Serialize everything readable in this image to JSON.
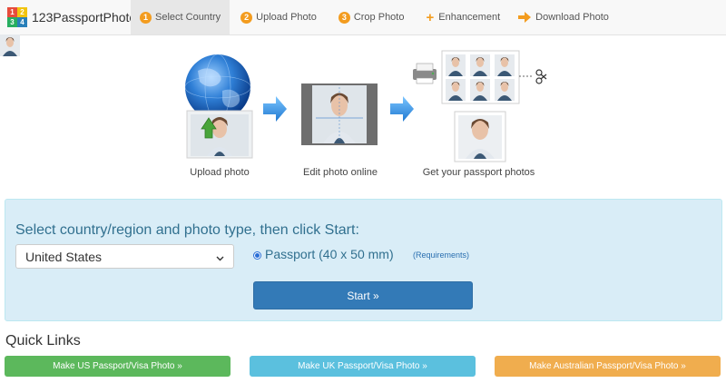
{
  "brand": {
    "name": "123PassportPhoto",
    "logo_digits": [
      "1",
      "2",
      "3",
      "4"
    ]
  },
  "nav": [
    {
      "label": "Select Country",
      "step": "1",
      "active": true
    },
    {
      "label": "Upload Photo",
      "step": "2"
    },
    {
      "label": "Crop Photo",
      "step": "3"
    },
    {
      "label": "Enhancement",
      "icon": "plus-icon"
    },
    {
      "label": "Download Photo",
      "icon": "arrow-right-icon"
    }
  ],
  "steps": {
    "upload_caption": "Upload photo",
    "edit_caption": "Edit photo online",
    "get_caption": "Get your passport photos"
  },
  "form": {
    "title": "Select country/region and photo type, then click Start:",
    "country_value": "United States",
    "photo_type": "Passport (40 x 50 mm)",
    "requirements_link": "(Requirements)",
    "start_label": "Start »"
  },
  "quick_links": {
    "title": "Quick Links",
    "items": [
      {
        "label": "Make US Passport/Visa Photo »",
        "color": "#5cb85c"
      },
      {
        "label": "Make UK Passport/Visa Photo »",
        "color": "#5bc0de"
      },
      {
        "label": "Make Australian Passport/Visa Photo »",
        "color": "#f0ad4e"
      }
    ]
  },
  "colors": {
    "accent_orange": "#f39c1f",
    "primary_blue": "#337ab7",
    "panel_bg": "#d9edf7",
    "panel_text": "#31708f"
  }
}
